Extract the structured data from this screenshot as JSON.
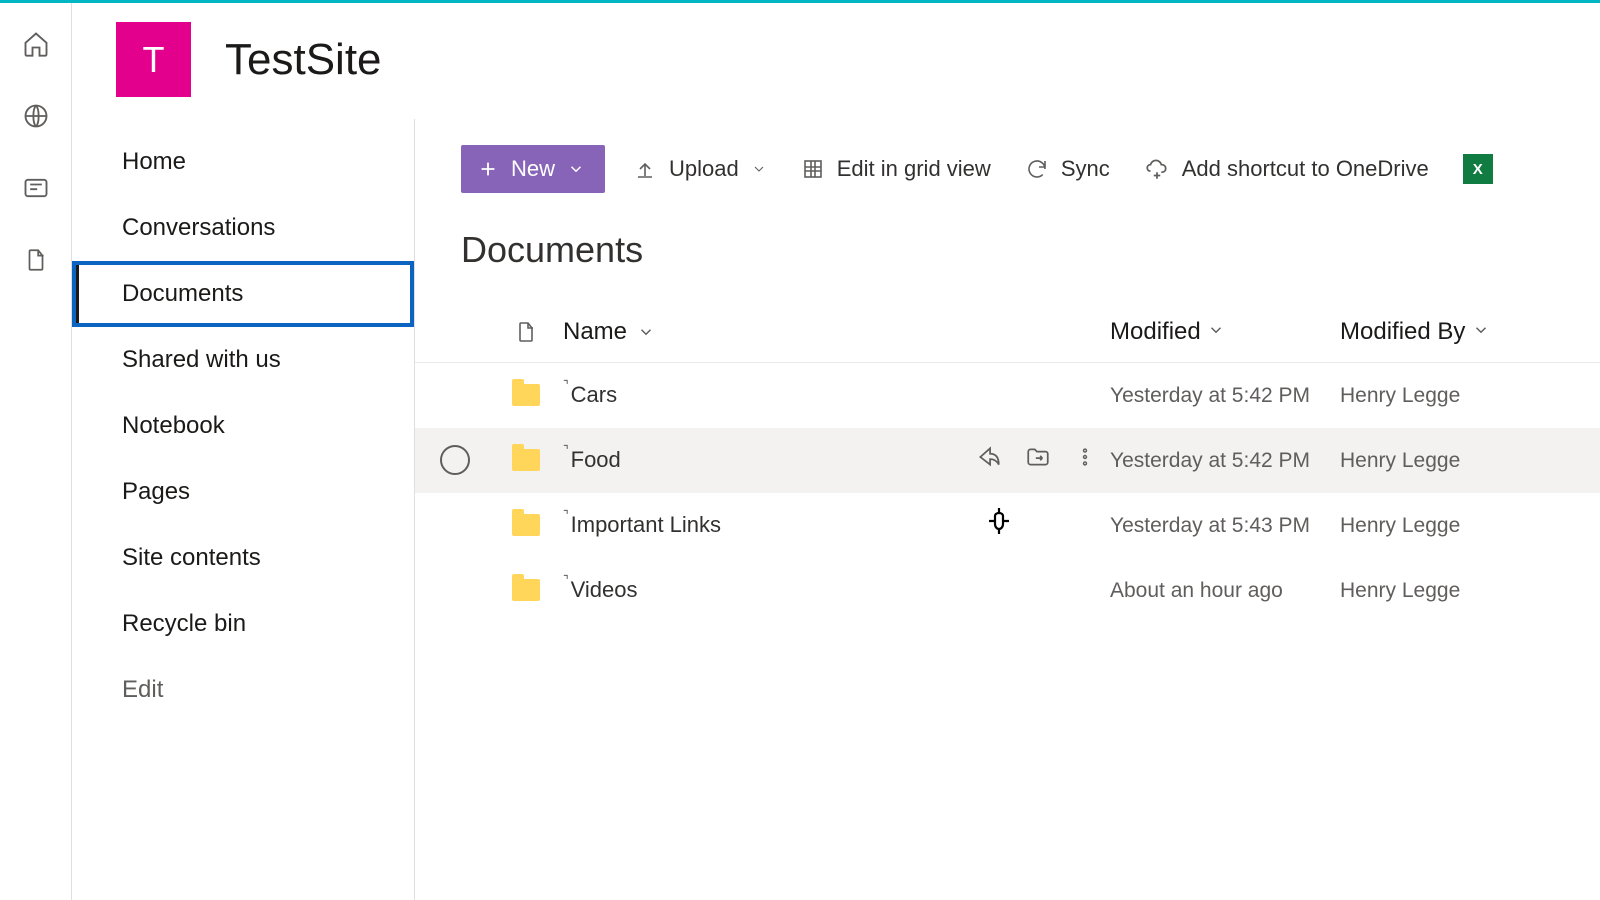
{
  "site": {
    "logo_letter": "T",
    "title": "TestSite"
  },
  "rail": {
    "items": [
      "home",
      "globe",
      "news",
      "file"
    ]
  },
  "nav": {
    "items": [
      {
        "label": "Home"
      },
      {
        "label": "Conversations"
      },
      {
        "label": "Documents",
        "selected": true
      },
      {
        "label": "Shared with us"
      },
      {
        "label": "Notebook"
      },
      {
        "label": "Pages"
      },
      {
        "label": "Site contents"
      },
      {
        "label": "Recycle bin"
      }
    ],
    "edit_label": "Edit"
  },
  "toolbar": {
    "new_label": "New",
    "upload_label": "Upload",
    "grid_label": "Edit in grid view",
    "sync_label": "Sync",
    "shortcut_label": "Add shortcut to OneDrive",
    "excel_letter": "X"
  },
  "page": {
    "title": "Documents"
  },
  "columns": {
    "name": "Name",
    "modified": "Modified",
    "modified_by": "Modified By"
  },
  "items": [
    {
      "name": "Cars",
      "modified": "Yesterday at 5:42 PM",
      "modified_by": "Henry Legge",
      "hovered": false
    },
    {
      "name": "Food",
      "modified": "Yesterday at 5:42 PM",
      "modified_by": "Henry Legge",
      "hovered": true
    },
    {
      "name": "Important Links",
      "modified": "Yesterday at 5:43 PM",
      "modified_by": "Henry Legge",
      "hovered": false
    },
    {
      "name": "Videos",
      "modified": "About an hour ago",
      "modified_by": "Henry Legge",
      "hovered": false
    }
  ]
}
